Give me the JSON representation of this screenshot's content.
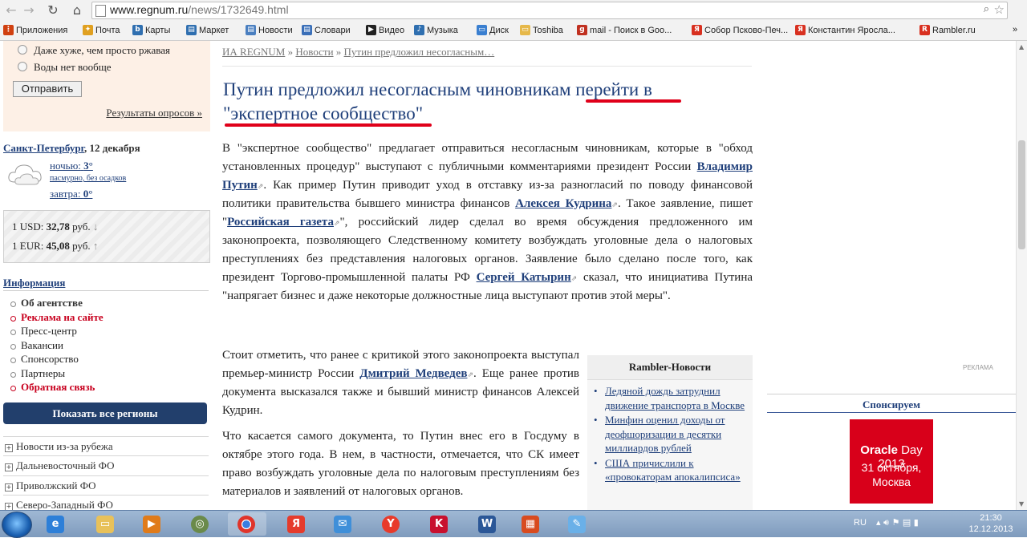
{
  "browser": {
    "url_host": "www.regnum.ru",
    "url_path": "/news/1732649.html",
    "bookmarks": [
      "Приложения",
      "Почта",
      "Карты",
      "Маркет",
      "Новости",
      "Словари",
      "Видео",
      "Музыка",
      "Диск",
      "Toshiba",
      "mail - Поиск в Goo...",
      "Собор Псково-Печ...",
      "Константин Яросла...",
      "Rambler.ru"
    ],
    "more": "»"
  },
  "poll": {
    "options": [
      "Даже хуже, чем просто ржавая",
      "Воды нет вообще"
    ],
    "submit": "Отправить",
    "results_link": "Результаты опросов »"
  },
  "weather": {
    "city": "Санкт-Петербург",
    "date": ", 12 декабря",
    "night_label": "ночью:",
    "night_temp": "3°",
    "description": "пасмурно, без осадков",
    "tomorrow_label": "завтра:",
    "tomorrow_temp": "0°"
  },
  "rates": [
    {
      "label": "1 USD:",
      "value": "32,78",
      "unit": "руб.",
      "arrow": "↓"
    },
    {
      "label": "1 EUR:",
      "value": "45,08",
      "unit": "руб.",
      "arrow": "↑"
    }
  ],
  "info": {
    "title": "Информация",
    "items": [
      "Об агентстве",
      "Реклама на сайте",
      "Пресс-центр",
      "Вакансии",
      "Спонсорство",
      "Партнеры",
      "Обратная связь"
    ],
    "show_regions": "Показать все регионы",
    "regions": [
      "Новости из-за рубежа",
      "Дальневосточный ФО",
      "Приволжский ФО",
      "Северо-Западный ФО"
    ]
  },
  "article": {
    "breadcrumb": [
      "ИА REGNUM",
      "Новости",
      "Путин предложил несогласным…"
    ],
    "breadcrumb_sep": "»",
    "headline": "Путин предложил несогласным чиновникам перейти в \"экспертное сообщество\"",
    "p1": [
      "В \"экспертное сообщество\" предлагает отправиться несогласным чиновникам, которые в \"обход установленных процедур\" выступают с публичными комментариями президент России ",
      "Владимир Путин",
      ". Как пример Путин приводит уход в отставку из-за разногласий по поводу финансовой политики правительства бывшего министра финансов ",
      "Алексея Кудрина",
      ". Такое заявление, пишет \"",
      "Российская газета",
      "\", российский лидер сделал во время обсуждения предложенного им законопроекта, позволяющего Следственному комитету возбуждать уголовные дела о налоговых преступлениях без представления налоговых органов. Заявление было сделано после того, как президент Торгово-промышленной палаты РФ ",
      "Сергей Катырин",
      " сказал, что инициатива Путина \"напрягает бизнес и даже некоторые должностные лица выступают против этой меры\"."
    ],
    "p2": [
      "Стоит отметить, что ранее с критикой этого законопроекта выступал премьер-министр России ",
      "Дмитрий Медведев",
      ". Еще ранее против документа высказался также и бывший министр финансов Алексей Кудрин."
    ],
    "p3": "Что касается самого документа, то Путин внес его в Госдуму в октябре этого года. В нем, в частности, отмечается, что СК имеет право возбуждать уголовные дела по налоговым преступлениям без материалов и заявлений от налоговых органов."
  },
  "rambler": {
    "title": "Rambler-Новости",
    "items": [
      "Ледяной дождь затруднил движение транспорта в Москве",
      "Минфин оценил доходы от деофшоризации в десятки миллиардов рублей",
      "США причислили к «провокаторам апокалипсиса»"
    ]
  },
  "right": {
    "ad_label": "РЕКЛАМА",
    "sponsor_title": "Спонсируем",
    "banner": {
      "brand": "Oracle",
      "event": "Day 2013",
      "date": "31 октября,",
      "city": "Москва"
    }
  },
  "taskbar": {
    "lang": "RU",
    "time": "21:30",
    "date": "12.12.2013"
  },
  "colors": {
    "link": "#1f3f7a",
    "accent_red": "#c8001e",
    "nav_button": "#223f6c",
    "banner": "#d8001a"
  }
}
